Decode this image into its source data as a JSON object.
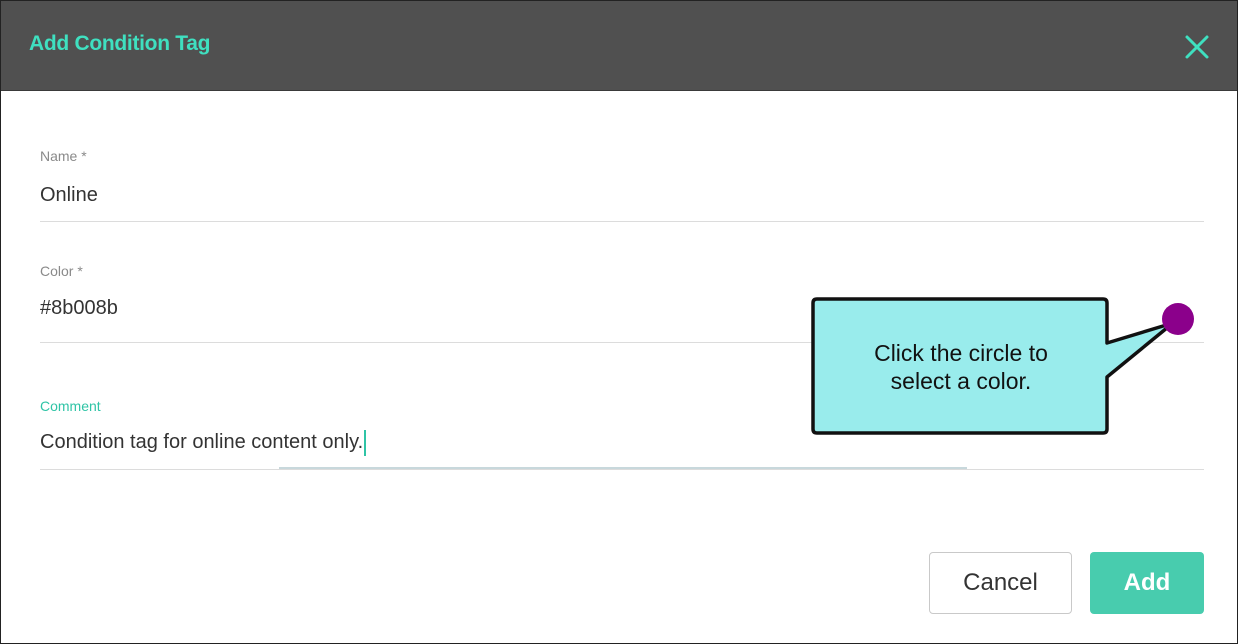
{
  "dialog": {
    "title": "Add Condition Tag",
    "close_icon": "close-icon",
    "accent_color": "#3fe0c0",
    "header_bg": "#505050"
  },
  "form": {
    "name": {
      "label": "Name *",
      "value": "Online"
    },
    "color": {
      "label": "Color *",
      "value": "#8b008b",
      "swatch_color": "#8b008b",
      "swatch_icon": "color-circle-icon"
    },
    "comment": {
      "label": "Comment",
      "value": "Condition tag for online content only."
    }
  },
  "callout": {
    "line1": "Click the circle to",
    "line2": "select a color.",
    "fill": "#99ecec"
  },
  "actions": {
    "cancel_label": "Cancel",
    "add_label": "Add",
    "add_color": "#48ccae"
  }
}
